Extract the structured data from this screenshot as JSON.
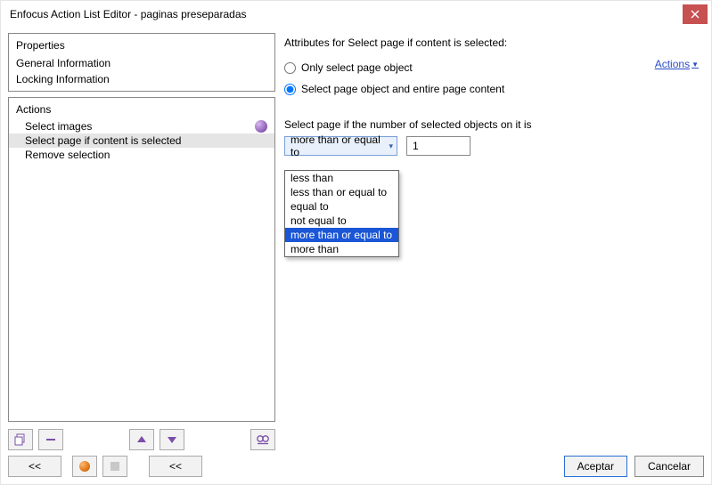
{
  "window": {
    "title": "Enfocus Action List Editor - paginas preseparadas"
  },
  "props": {
    "header": "Properties",
    "items": [
      "General Information",
      "Locking Information"
    ]
  },
  "actions": {
    "header": "Actions",
    "items": [
      "Select images",
      "Select page if content is selected",
      "Remove selection"
    ],
    "selected_index": 1
  },
  "right": {
    "attr_title": "Attributes for Select page if content is selected:",
    "radio1": "Only select page object",
    "radio2": "Select page object and entire page content",
    "actions_link": "Actions",
    "select_label": "Select page if the number of selected objects on it is",
    "combo_value": "more than or equal to",
    "num_value": "1",
    "options": [
      "less than",
      "less than or equal to",
      "equal to",
      "not equal to",
      "more than or equal to",
      "more than"
    ],
    "selected_option_index": 4
  },
  "nav": {
    "back1": "<<",
    "back2": "<<"
  },
  "footer": {
    "ok": "Aceptar",
    "cancel": "Cancelar"
  }
}
